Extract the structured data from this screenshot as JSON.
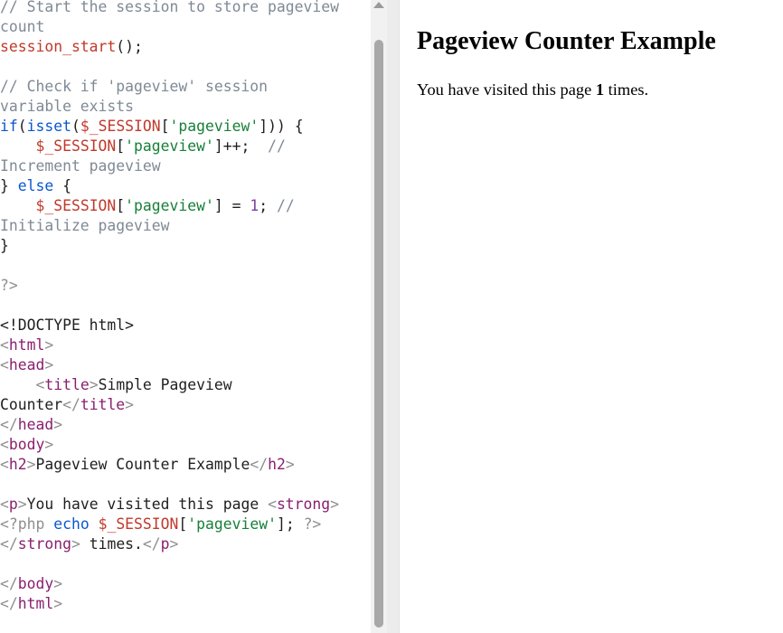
{
  "editor": {
    "lines": [
      [
        {
          "t": "// Start the session to store pageview",
          "c": "c"
        }
      ],
      [
        {
          "t": "count",
          "c": "c"
        }
      ],
      [
        {
          "t": "session_start",
          "c": "var"
        },
        {
          "t": "();",
          "c": "plain"
        }
      ],
      [],
      [
        {
          "t": "// Check if 'pageview' session",
          "c": "c"
        }
      ],
      [
        {
          "t": "variable exists",
          "c": "c"
        }
      ],
      [
        {
          "t": "if",
          "c": "kw"
        },
        {
          "t": "(",
          "c": "plain"
        },
        {
          "t": "isset",
          "c": "fn"
        },
        {
          "t": "(",
          "c": "plain"
        },
        {
          "t": "$_SESSION",
          "c": "var"
        },
        {
          "t": "[",
          "c": "plain"
        },
        {
          "t": "'pageview'",
          "c": "str"
        },
        {
          "t": "])) {",
          "c": "plain"
        }
      ],
      [
        {
          "t": "    ",
          "c": "plain"
        },
        {
          "t": "$_SESSION",
          "c": "var"
        },
        {
          "t": "[",
          "c": "plain"
        },
        {
          "t": "'pageview'",
          "c": "str"
        },
        {
          "t": "]++;  ",
          "c": "plain"
        },
        {
          "t": "//",
          "c": "c"
        }
      ],
      [
        {
          "t": "Increment pageview",
          "c": "c"
        }
      ],
      [
        {
          "t": "} ",
          "c": "plain"
        },
        {
          "t": "else",
          "c": "kw"
        },
        {
          "t": " {",
          "c": "plain"
        }
      ],
      [
        {
          "t": "    ",
          "c": "plain"
        },
        {
          "t": "$_SESSION",
          "c": "var"
        },
        {
          "t": "[",
          "c": "plain"
        },
        {
          "t": "'pageview'",
          "c": "str"
        },
        {
          "t": "] = ",
          "c": "plain"
        },
        {
          "t": "1",
          "c": "num"
        },
        {
          "t": "; ",
          "c": "plain"
        },
        {
          "t": "//",
          "c": "c"
        }
      ],
      [
        {
          "t": "Initialize pageview",
          "c": "c"
        }
      ],
      [
        {
          "t": "}",
          "c": "plain"
        }
      ],
      [],
      [
        {
          "t": "?>",
          "c": "brk"
        }
      ],
      [],
      [
        {
          "t": "<!DOCTYPE html>",
          "c": "plain"
        }
      ],
      [
        {
          "t": "<",
          "c": "brk"
        },
        {
          "t": "html",
          "c": "tag"
        },
        {
          "t": ">",
          "c": "brk"
        }
      ],
      [
        {
          "t": "<",
          "c": "brk"
        },
        {
          "t": "head",
          "c": "tag"
        },
        {
          "t": ">",
          "c": "brk"
        }
      ],
      [
        {
          "t": "    ",
          "c": "plain"
        },
        {
          "t": "<",
          "c": "brk"
        },
        {
          "t": "title",
          "c": "tag"
        },
        {
          "t": ">",
          "c": "brk"
        },
        {
          "t": "Simple Pageview",
          "c": "plain"
        }
      ],
      [
        {
          "t": "Counter",
          "c": "plain"
        },
        {
          "t": "</",
          "c": "brk"
        },
        {
          "t": "title",
          "c": "tag"
        },
        {
          "t": ">",
          "c": "brk"
        }
      ],
      [
        {
          "t": "</",
          "c": "brk"
        },
        {
          "t": "head",
          "c": "tag"
        },
        {
          "t": ">",
          "c": "brk"
        }
      ],
      [
        {
          "t": "<",
          "c": "brk"
        },
        {
          "t": "body",
          "c": "tag"
        },
        {
          "t": ">",
          "c": "brk"
        }
      ],
      [
        {
          "t": "<",
          "c": "brk"
        },
        {
          "t": "h2",
          "c": "tag"
        },
        {
          "t": ">",
          "c": "brk"
        },
        {
          "t": "Pageview Counter Example",
          "c": "plain"
        },
        {
          "t": "</",
          "c": "brk"
        },
        {
          "t": "h2",
          "c": "tag"
        },
        {
          "t": ">",
          "c": "brk"
        }
      ],
      [],
      [
        {
          "t": "<",
          "c": "brk"
        },
        {
          "t": "p",
          "c": "tag"
        },
        {
          "t": ">",
          "c": "brk"
        },
        {
          "t": "You have visited this page ",
          "c": "plain"
        },
        {
          "t": "<",
          "c": "brk"
        },
        {
          "t": "strong",
          "c": "tag"
        },
        {
          "t": ">",
          "c": "brk"
        }
      ],
      [
        {
          "t": "<?php ",
          "c": "brk"
        },
        {
          "t": "echo",
          "c": "kw"
        },
        {
          "t": " ",
          "c": "plain"
        },
        {
          "t": "$_SESSION",
          "c": "var"
        },
        {
          "t": "[",
          "c": "plain"
        },
        {
          "t": "'pageview'",
          "c": "str"
        },
        {
          "t": "]; ",
          "c": "plain"
        },
        {
          "t": "?>",
          "c": "brk"
        }
      ],
      [
        {
          "t": "</",
          "c": "brk"
        },
        {
          "t": "strong",
          "c": "tag"
        },
        {
          "t": ">",
          "c": "brk"
        },
        {
          "t": " times.",
          "c": "plain"
        },
        {
          "t": "</",
          "c": "brk"
        },
        {
          "t": "p",
          "c": "tag"
        },
        {
          "t": ">",
          "c": "brk"
        }
      ],
      [],
      [
        {
          "t": "</",
          "c": "brk"
        },
        {
          "t": "body",
          "c": "tag"
        },
        {
          "t": ">",
          "c": "brk"
        }
      ],
      [
        {
          "t": "</",
          "c": "brk"
        },
        {
          "t": "html",
          "c": "tag"
        },
        {
          "t": ">",
          "c": "brk"
        }
      ]
    ]
  },
  "preview": {
    "heading": "Pageview Counter Example",
    "text_before": "You have visited this page ",
    "count": "1",
    "text_after": " times."
  },
  "colors": {
    "comment": "#7f8a95",
    "keyword": "#0b57d0",
    "variable": "#c0392b",
    "string": "#188038",
    "number": "#7a3ea1",
    "tag": "#8a1f6f",
    "bracket": "#8f8f8f"
  },
  "icons": {
    "scroll_up": "triangle-up"
  }
}
